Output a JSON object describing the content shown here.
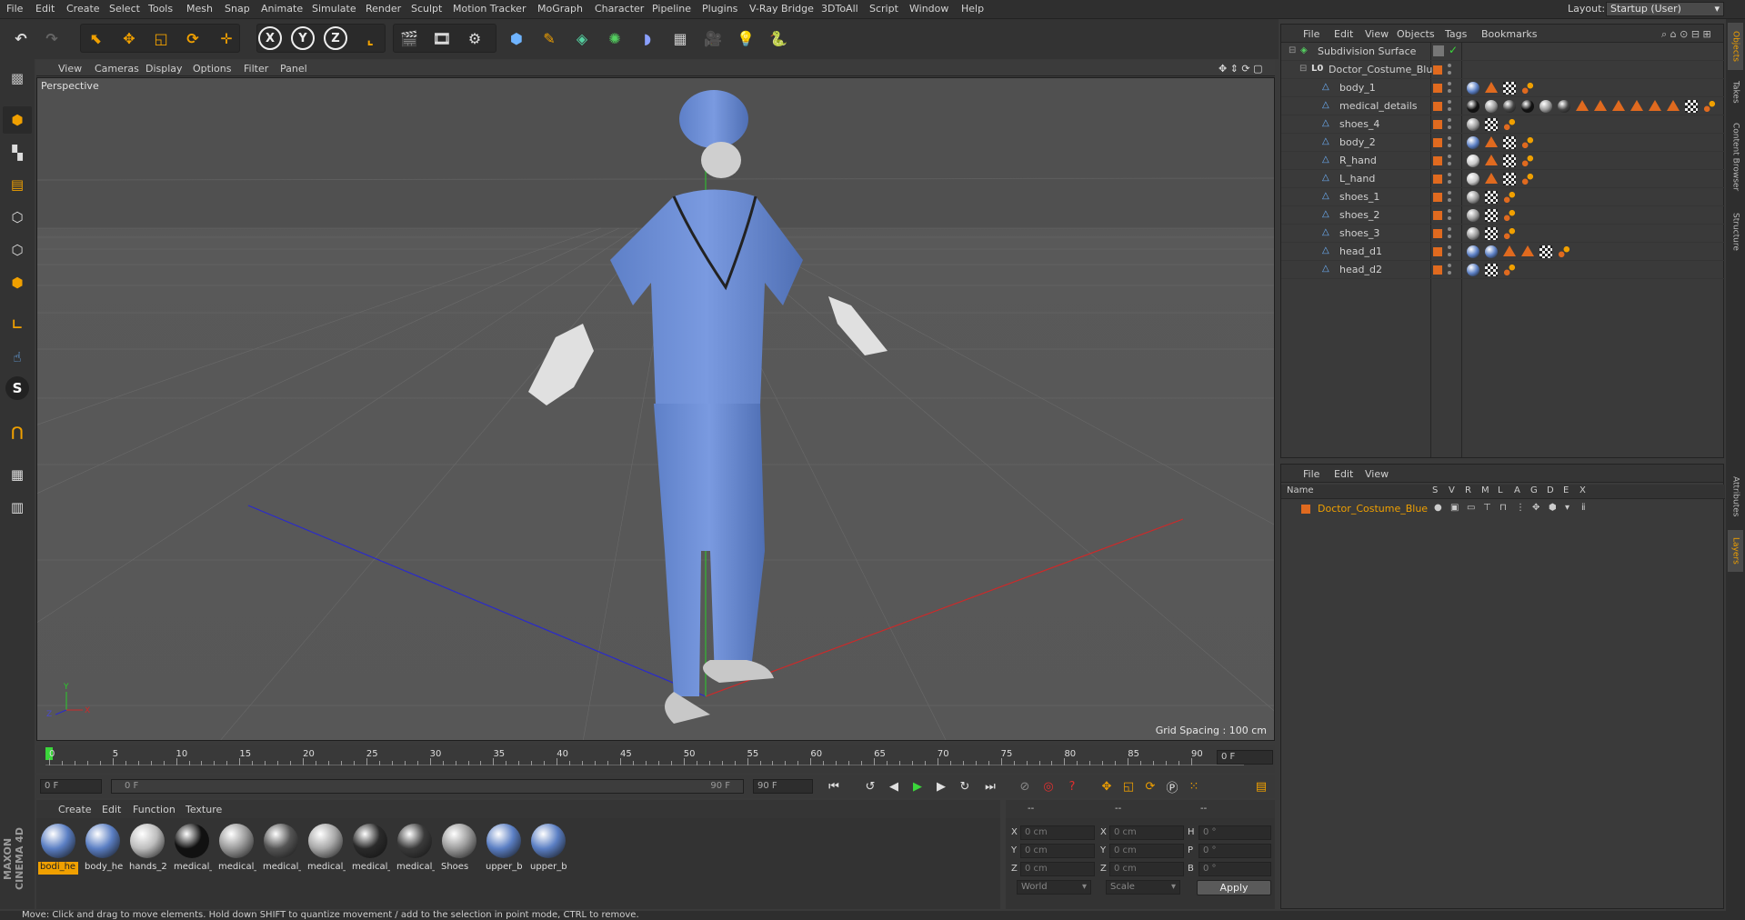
{
  "menubar": {
    "items": [
      "File",
      "Edit",
      "Create",
      "Select",
      "Tools",
      "Mesh",
      "Snap",
      "Animate",
      "Simulate",
      "Render",
      "Sculpt",
      "Motion Tracker",
      "MoGraph",
      "Character",
      "Pipeline",
      "Plugins",
      "V-Ray Bridge",
      "3DToAll",
      "Script",
      "Window",
      "Help"
    ],
    "layout_label": "Layout:",
    "layout_value": "Startup (User)"
  },
  "viewport": {
    "menu": [
      "View",
      "Cameras",
      "Display",
      "Options",
      "Filter",
      "Panel"
    ],
    "name": "Perspective",
    "grid_spacing": "Grid Spacing : 100 cm"
  },
  "timeline": {
    "ticks": [
      "0",
      "5",
      "10",
      "15",
      "20",
      "25",
      "30",
      "35",
      "40",
      "45",
      "50",
      "55",
      "60",
      "65",
      "70",
      "75",
      "80",
      "85",
      "90"
    ],
    "current_frame": "0 F"
  },
  "transport": {
    "start_field": "0 F",
    "range_start": "0 F",
    "range_end": "90 F",
    "end_field": "90 F"
  },
  "material_manager": {
    "menu": [
      "Create",
      "Edit",
      "Function",
      "Texture"
    ],
    "materials": [
      {
        "name": "bodi_he",
        "color": "#5b7fc4",
        "selected": true
      },
      {
        "name": "body_he",
        "color": "#5b7fc4",
        "selected": false
      },
      {
        "name": "hands_2",
        "color": "#bdbdbd",
        "selected": false
      },
      {
        "name": "medical_",
        "color": "#111111",
        "selected": false
      },
      {
        "name": "medical_",
        "color": "#9a9a9a",
        "selected": false
      },
      {
        "name": "medical_",
        "color": "#555555",
        "selected": false
      },
      {
        "name": "medical_",
        "color": "#a8a8a8",
        "selected": false
      },
      {
        "name": "medical_",
        "color": "#2a2a2a",
        "selected": false
      },
      {
        "name": "medical_",
        "color": "#3a3a3a",
        "selected": false
      },
      {
        "name": "Shoes",
        "color": "#9c9c9c",
        "selected": false
      },
      {
        "name": "upper_b",
        "color": "#5b7fc4",
        "selected": false
      },
      {
        "name": "upper_b",
        "color": "#5b7fc4",
        "selected": false
      }
    ]
  },
  "coordinates": {
    "header1": "--",
    "header2": "--",
    "header3": "--",
    "rows": [
      {
        "l1": "X",
        "v1": "0 cm",
        "l2": "X",
        "v2": "0 cm",
        "l3": "H",
        "v3": "0 °"
      },
      {
        "l1": "Y",
        "v1": "0 cm",
        "l2": "Y",
        "v2": "0 cm",
        "l3": "P",
        "v3": "0 °"
      },
      {
        "l1": "Z",
        "v1": "0 cm",
        "l2": "Z",
        "v2": "0 cm",
        "l3": "B",
        "v3": "0 °"
      }
    ],
    "mode_select": "World",
    "scale_select": "Scale",
    "apply_label": "Apply"
  },
  "object_manager": {
    "menu": [
      "File",
      "Edit",
      "View",
      "Objects",
      "Tags",
      "Bookmarks"
    ],
    "objects": [
      {
        "name": "Subdivision Surface",
        "level": 0,
        "type": "subdiv"
      },
      {
        "name": "Doctor_Costume_Blue",
        "level": 1,
        "type": "null"
      },
      {
        "name": "body_1",
        "level": 2,
        "tags": [
          "mat-blue",
          "tri",
          "check",
          "dot"
        ]
      },
      {
        "name": "medical_details",
        "level": 2,
        "tags": [
          "mat-black",
          "mat-grey",
          "mat-dark",
          "mat-black",
          "mat-grey",
          "mat-dark",
          "tri",
          "tri",
          "tri",
          "tri",
          "tri",
          "tri",
          "check",
          "dot"
        ]
      },
      {
        "name": "shoes_4",
        "level": 2,
        "tags": [
          "mat-grey",
          "check",
          "dot"
        ]
      },
      {
        "name": "body_2",
        "level": 2,
        "tags": [
          "mat-blue",
          "tri",
          "check",
          "dot"
        ]
      },
      {
        "name": "R_hand",
        "level": 2,
        "tags": [
          "mat-light",
          "tri",
          "check",
          "dot"
        ]
      },
      {
        "name": "L_hand",
        "level": 2,
        "tags": [
          "mat-light",
          "tri",
          "check",
          "dot"
        ]
      },
      {
        "name": "shoes_1",
        "level": 2,
        "tags": [
          "mat-grey",
          "check",
          "dot"
        ]
      },
      {
        "name": "shoes_2",
        "level": 2,
        "tags": [
          "mat-grey",
          "check",
          "dot"
        ]
      },
      {
        "name": "shoes_3",
        "level": 2,
        "tags": [
          "mat-grey",
          "check",
          "dot"
        ]
      },
      {
        "name": "head_d1",
        "level": 2,
        "tags": [
          "mat-blue",
          "mat-blue",
          "tri",
          "tri",
          "check",
          "dot"
        ]
      },
      {
        "name": "head_d2",
        "level": 2,
        "tags": [
          "mat-blue",
          "check",
          "dot"
        ]
      }
    ]
  },
  "layer_manager": {
    "menu": [
      "File",
      "Edit",
      "View"
    ],
    "columns": [
      "Name",
      "S",
      "V",
      "R",
      "M",
      "L",
      "A",
      "G",
      "D",
      "E",
      "X"
    ],
    "layers": [
      {
        "name": "Doctor_Costume_Blue",
        "color": "#e06a1f"
      }
    ]
  },
  "right_tabs": [
    "Objects",
    "Takes",
    "Content Browser",
    "Structure",
    "Attributes",
    "Layers"
  ],
  "branding": "MAXON CINEMA 4D",
  "status_text": "Move: Click and drag to move elements. Hold down SHIFT to quantize movement / add to the selection in point mode, CTRL to remove.",
  "colors": {
    "accent": "#e06a1f",
    "selection": "#f0a000",
    "scrubs": "#5b7fc4"
  }
}
